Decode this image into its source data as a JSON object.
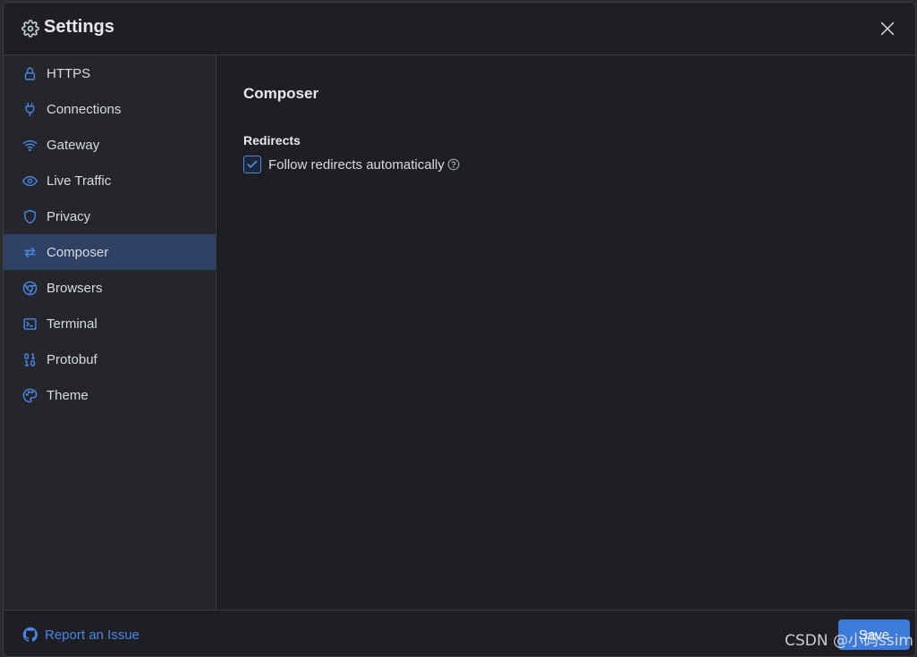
{
  "header": {
    "title": "Settings"
  },
  "sidebar": {
    "items": [
      {
        "label": "HTTPS",
        "icon": "lock-icon"
      },
      {
        "label": "Connections",
        "icon": "plug-icon"
      },
      {
        "label": "Gateway",
        "icon": "wifi-icon"
      },
      {
        "label": "Live Traffic",
        "icon": "eye-icon"
      },
      {
        "label": "Privacy",
        "icon": "shield-icon"
      },
      {
        "label": "Composer",
        "icon": "arrows-swap-icon",
        "active": true
      },
      {
        "label": "Browsers",
        "icon": "chrome-icon"
      },
      {
        "label": "Terminal",
        "icon": "terminal-icon"
      },
      {
        "label": "Protobuf",
        "icon": "binary-icon"
      },
      {
        "label": "Theme",
        "icon": "palette-icon"
      }
    ]
  },
  "content": {
    "section_title": "Composer",
    "group_title": "Redirects",
    "option_label": "Follow redirects automatically",
    "option_checked": true
  },
  "footer": {
    "report_label": "Report an Issue",
    "save_label": "Save"
  },
  "watermark": "CSDN @小码ssim",
  "colors": {
    "accent": "#4a86e8",
    "active_bg": "#2f4263",
    "background": "#1e1f24"
  }
}
